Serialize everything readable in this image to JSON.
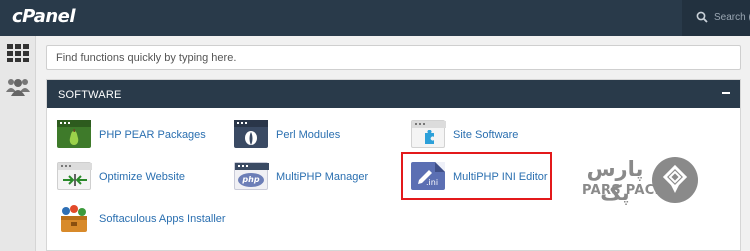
{
  "topbar": {
    "logo": "cPanel",
    "search_placeholder": "Search ("
  },
  "sidebar": {
    "items": [
      {
        "icon": "grid-icon"
      },
      {
        "icon": "users-icon"
      }
    ]
  },
  "quick_search": {
    "placeholder": "Find functions quickly by typing here."
  },
  "software_panel": {
    "title": "SOFTWARE",
    "collapse_icon": "minus-icon",
    "items": [
      {
        "label": "PHP PEAR Packages",
        "icon": "php-pear-icon"
      },
      {
        "label": "Perl Modules",
        "icon": "perl-modules-icon"
      },
      {
        "label": "Site Software",
        "icon": "site-software-icon"
      },
      {
        "label": "Optimize Website",
        "icon": "optimize-website-icon"
      },
      {
        "label": "MultiPHP Manager",
        "icon": "multiphp-manager-icon",
        "badge": "php"
      },
      {
        "label": "MultiPHP INI Editor",
        "icon": "multiphp-ini-editor-icon",
        "badge": ".ini"
      },
      {
        "label": "Softaculous Apps Installer",
        "icon": "softaculous-icon"
      }
    ]
  },
  "watermark": {
    "name_fa": "پارس پک",
    "name_en": "PARS PACK"
  },
  "colors": {
    "header": "#293a4a",
    "link": "#2a6fb0",
    "highlight": "#e3191b",
    "watermark": "#8a8a8a"
  }
}
